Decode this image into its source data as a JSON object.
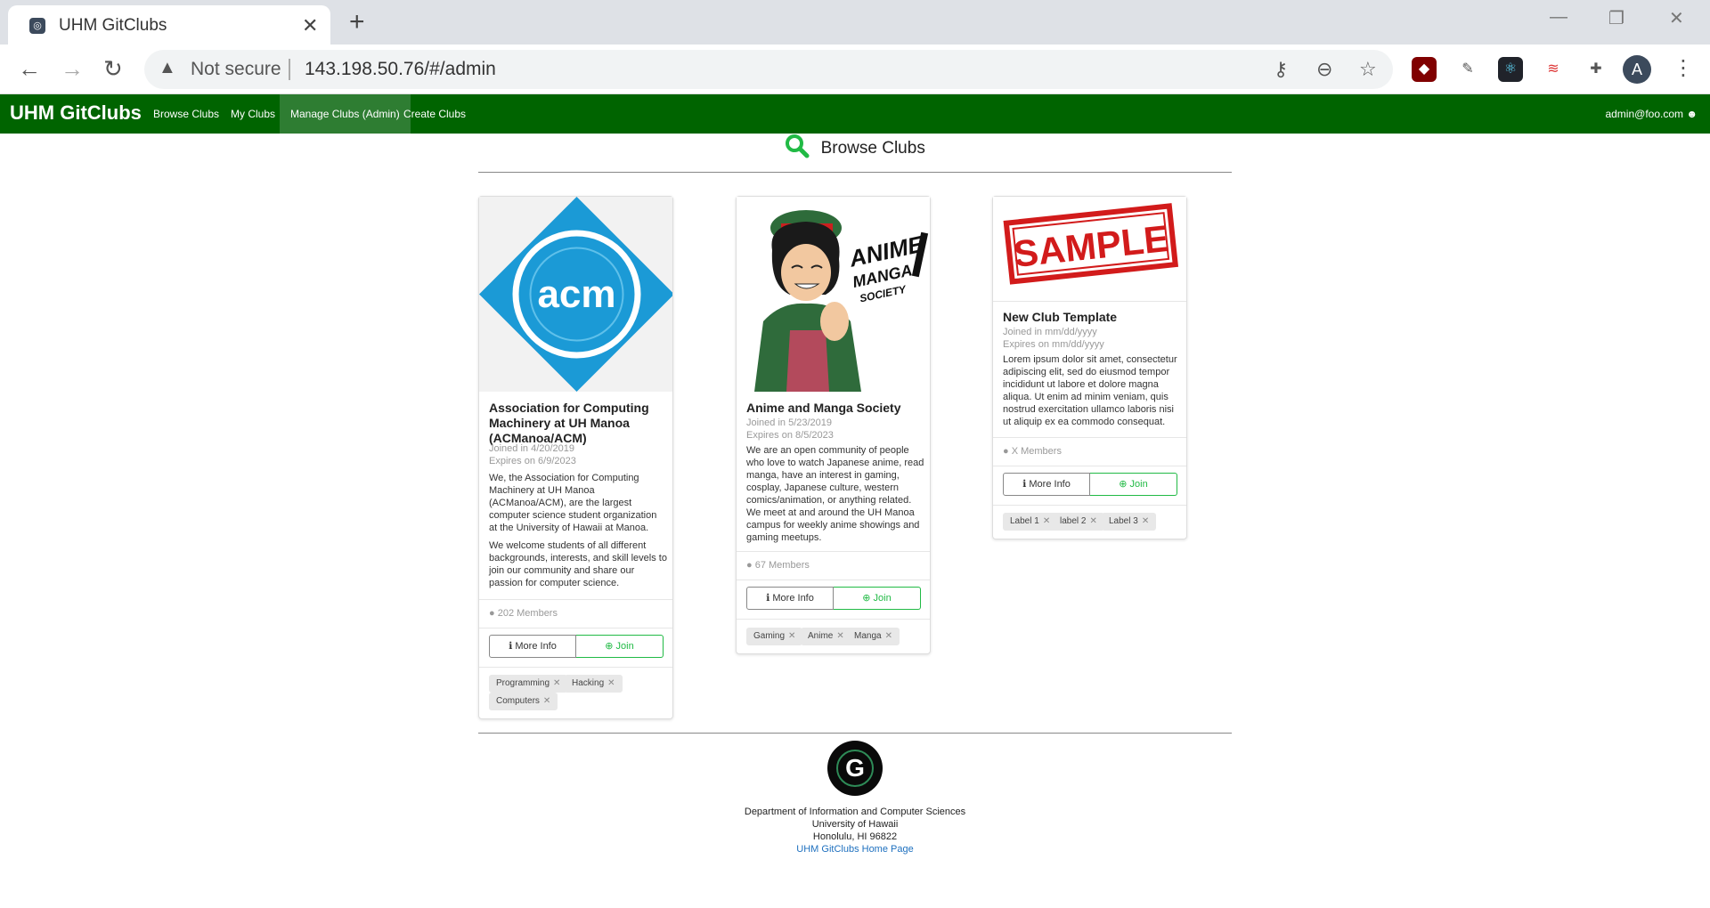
{
  "browser": {
    "tab_title": "UHM GitClubs",
    "tab_close": "✕",
    "new_tab": "+",
    "not_secure": "Not secure",
    "url": "143.198.50.76/#/admin",
    "avatar_letter": "A"
  },
  "navbar": {
    "brand": "UHM GitClubs",
    "links": [
      "Browse Clubs",
      "My Clubs",
      "Manage Clubs (Admin)",
      "Create Clubs"
    ],
    "active_index": 2,
    "user": "admin@foo.com",
    "color": "#006400"
  },
  "page": {
    "title": "Browse Clubs"
  },
  "cards": [
    {
      "title": "Association for Computing Machinery at UH Manoa (ACManoa/ACM)",
      "image": "acm",
      "joined": "Joined in 4/20/2019",
      "expires": "Expires on 6/9/2023",
      "desc1": "We, the Association for Computing Machinery at UH Manoa (ACManoa/ACM), are the largest computer science student organization at the University of Hawaii at Manoa.",
      "desc2": "We welcome students of all different backgrounds, interests, and skill levels to join our community and share our passion for computer science.",
      "members": "202 Members",
      "more_info": "More Info",
      "join": "Join",
      "tags": [
        "Programming",
        "Hacking",
        "Computers"
      ]
    },
    {
      "title": "Anime and Manga Society",
      "image": "anime",
      "joined": "Joined in 5/23/2019",
      "expires": "Expires on 8/5/2023",
      "desc1": "We are an open community of people who love to watch Japanese anime, read manga, have an interest in gaming, cosplay, Japanese culture, western comics/animation, or anything related. We meet at and around the UH Manoa campus for weekly anime showings and gaming meetups.",
      "members": "67 Members",
      "more_info": "More Info",
      "join": "Join",
      "tags": [
        "Gaming",
        "Anime",
        "Manga"
      ]
    },
    {
      "title": "New Club Template",
      "image": "sample",
      "joined": "Joined in mm/dd/yyyy",
      "expires": "Expires on mm/dd/yyyy",
      "desc1": "Lorem ipsum dolor sit amet, consectetur adipiscing elit, sed do eiusmod tempor incididunt ut labore et dolore magna aliqua. Ut enim ad minim veniam, quis nostrud exercitation ullamco laboris nisi ut aliquip ex ea commodo consequat.",
      "members": "X Members",
      "more_info": "More Info",
      "join": "Join",
      "tags": [
        "Label 1",
        "label 2",
        "Label 3"
      ]
    }
  ],
  "images": {
    "acm_text": "acm",
    "anime_text_1": "ANIME",
    "anime_text_2": "MANGA",
    "anime_text_3": "SOCIETY",
    "sample_text": "SAMPLE"
  },
  "footer": {
    "logo_letter": "G",
    "line1": "Department of Information and Computer Sciences",
    "line2": "University of Hawaii",
    "line3": "Honolulu, HI 96822",
    "link": "UHM GitClubs Home Page"
  }
}
